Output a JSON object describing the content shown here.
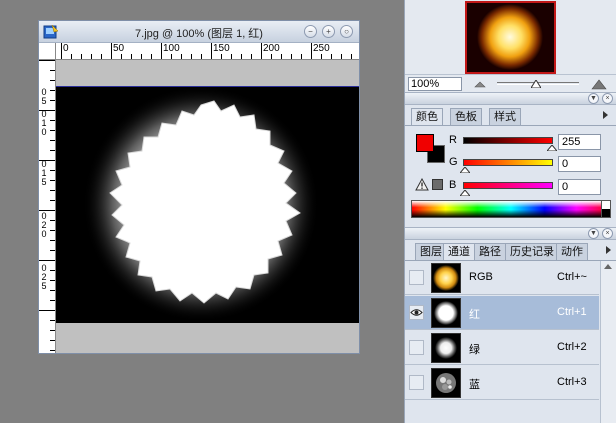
{
  "document": {
    "title": "7.jpg @ 100% (图层 1, 红)",
    "ruler_h_labels": [
      "0",
      "50",
      "100",
      "150",
      "200",
      "250"
    ],
    "ruler_v_labels": [
      "0",
      "5",
      "0",
      "1",
      "0",
      "0",
      "1",
      "5",
      "0",
      "2",
      "0",
      "0",
      "2",
      "5"
    ]
  },
  "navigator": {
    "zoom": "100%"
  },
  "color_panel": {
    "tabs": [
      "颜色",
      "色板",
      "样式"
    ],
    "channels": [
      {
        "label": "R",
        "value": "255"
      },
      {
        "label": "G",
        "value": "0"
      },
      {
        "label": "B",
        "value": "0"
      }
    ],
    "foreground_color": "#f00000",
    "background_color": "#000000"
  },
  "channels_panel": {
    "tabs": [
      "图层",
      "通道",
      "路径",
      "历史记录",
      "动作"
    ],
    "rows": [
      {
        "name": "RGB",
        "shortcut": "Ctrl+~",
        "visible": false,
        "selected": false
      },
      {
        "name": "红",
        "shortcut": "Ctrl+1",
        "visible": true,
        "selected": true
      },
      {
        "name": "绿",
        "shortcut": "Ctrl+2",
        "visible": false,
        "selected": false
      },
      {
        "name": "蓝",
        "shortcut": "Ctrl+3",
        "visible": false,
        "selected": false
      }
    ]
  },
  "icons": {
    "app": "photoshop-doc-icon",
    "minimize": "minimize-icon",
    "maximize": "maximize-icon",
    "close": "close-icon",
    "eye": "eye-icon",
    "warning": "gamut-warning-icon"
  }
}
